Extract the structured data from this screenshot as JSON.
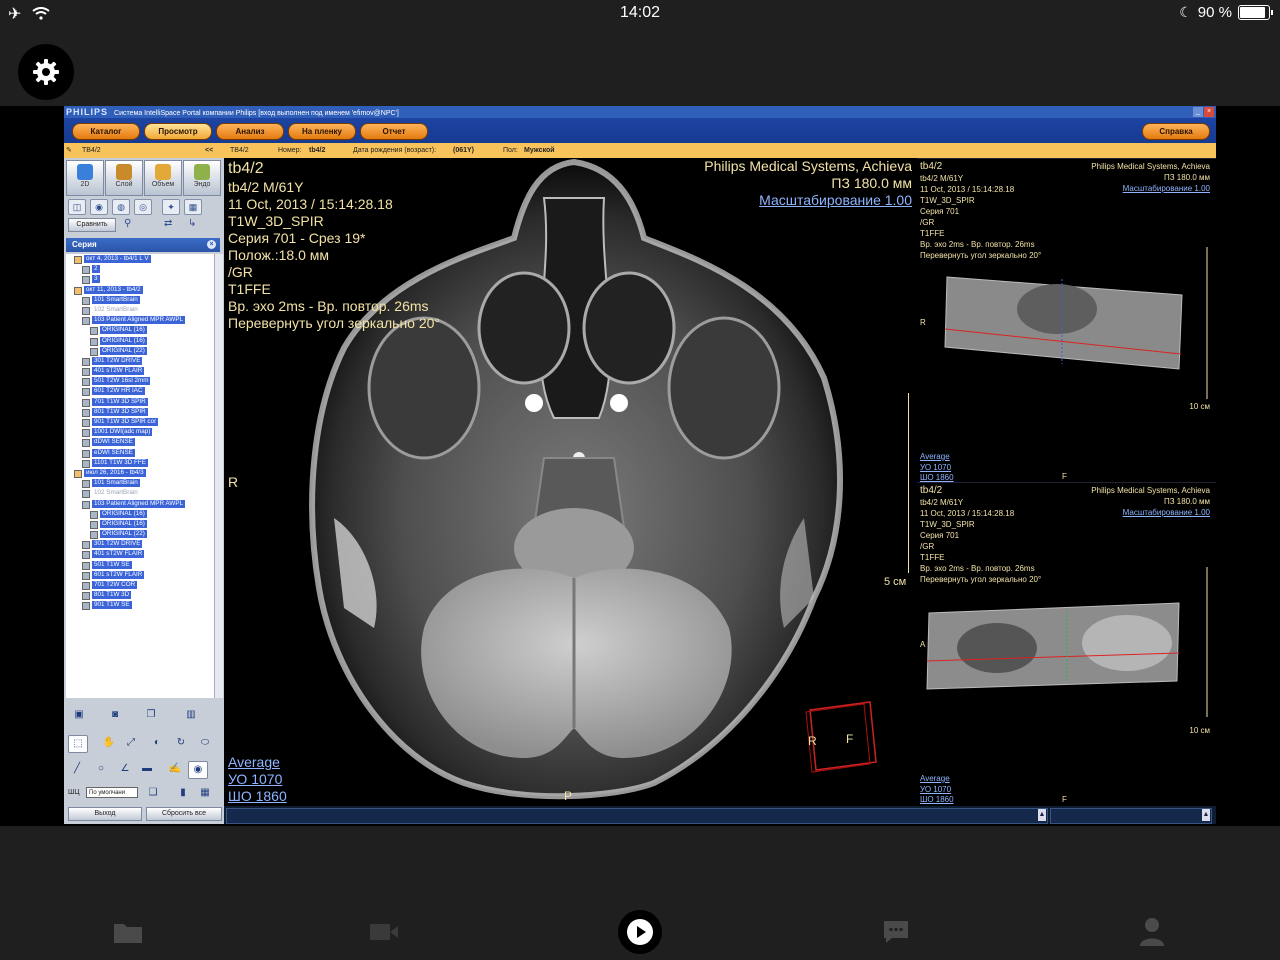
{
  "ios": {
    "time": "14:02",
    "battery": "90 %",
    "battery_level": 0.9
  },
  "window": {
    "brand": "PHILIPS",
    "title": "Система IntelliSpace Portal компании Philips [вход выполнен под именем 'efimov@NPC']",
    "menu": {
      "catalog": "Каталог",
      "view": "Просмотр",
      "analysis": "Анализ",
      "to_film": "На пленку",
      "report": "Отчет",
      "help": "Справка"
    }
  },
  "infobar": {
    "patient_tab": "ТВ4/2",
    "close_tab": "<<",
    "patient": "ТВ4/2",
    "number_label": "Номер:",
    "number_value": "tb4/2",
    "dob_label": "Дата рождения (возраст):",
    "dob_value": "(061Y)",
    "sex_label": "Пол:",
    "sex_value": "Мужской"
  },
  "left_panel": {
    "tools": [
      {
        "label": "2D",
        "color": "#3a7fd9"
      },
      {
        "label": "Слой",
        "color": "#c88a2a"
      },
      {
        "label": "Объем",
        "color": "#e2a938"
      },
      {
        "label": "Эндо",
        "color": "#8fb14c"
      }
    ],
    "compare": "Сравнить",
    "series_header": "Серия",
    "tree": [
      {
        "indent": 0,
        "box": "study",
        "label": "окт 4, 2013 - tb4/1 L V",
        "gray": false
      },
      {
        "indent": 1,
        "box": "series",
        "label": "2",
        "gray": false
      },
      {
        "indent": 1,
        "box": "series",
        "label": "3",
        "gray": false
      },
      {
        "indent": 0,
        "box": "study",
        "label": "окт 11, 2013 - tb4/2",
        "gray": false
      },
      {
        "indent": 1,
        "box": "series",
        "label": "101 SmartBrain",
        "gray": false
      },
      {
        "indent": 1,
        "box": "series",
        "label": "102 SmartBrain",
        "gray": true
      },
      {
        "indent": 1,
        "box": "series",
        "label": "103 Patient Aligned MPR AWPL",
        "gray": false
      },
      {
        "indent": 2,
        "box": "series",
        "label": "ORIGINAL (16)",
        "gray": false
      },
      {
        "indent": 2,
        "box": "series",
        "label": "ORIGINAL (16)",
        "gray": false
      },
      {
        "indent": 2,
        "box": "series",
        "label": "ORIGINAL (22)",
        "gray": false
      },
      {
        "indent": 1,
        "box": "series",
        "label": "301 T2W DRIVE",
        "gray": false
      },
      {
        "indent": 1,
        "box": "series",
        "label": "401 sT2W FLAIR",
        "gray": false
      },
      {
        "indent": 1,
        "box": "series",
        "label": "501 T2W 16sl 2mm",
        "gray": false
      },
      {
        "indent": 1,
        "box": "series",
        "label": "601 T2W HR IAC",
        "gray": false
      },
      {
        "indent": 1,
        "box": "series",
        "label": "701 T1W 3D SPIR",
        "gray": false
      },
      {
        "indent": 1,
        "box": "series",
        "label": "801 T1W 3D SPIR",
        "gray": false
      },
      {
        "indent": 1,
        "box": "series",
        "label": "901 T1W 3D SPIR cor",
        "gray": false
      },
      {
        "indent": 1,
        "box": "series",
        "label": "1001 DWI(adc map)",
        "gray": false
      },
      {
        "indent": 1,
        "box": "series",
        "label": "dDWI SENSE",
        "gray": false
      },
      {
        "indent": 1,
        "box": "series",
        "label": "eDWI SENSE",
        "gray": false
      },
      {
        "indent": 1,
        "box": "series",
        "label": "1101 T1W 3D FFE",
        "gray": false
      },
      {
        "indent": 0,
        "box": "study",
        "label": "июл 26, 2016 - tb4/3",
        "gray": false
      },
      {
        "indent": 1,
        "box": "series",
        "label": "101 SmartBrain",
        "gray": false
      },
      {
        "indent": 1,
        "box": "series",
        "label": "102 SmartBrain",
        "gray": true
      },
      {
        "indent": 1,
        "box": "series",
        "label": "103 Patient Aligned MPR AWPL",
        "gray": false
      },
      {
        "indent": 2,
        "box": "series",
        "label": "ORIGINAL (16)",
        "gray": false
      },
      {
        "indent": 2,
        "box": "series",
        "label": "ORIGINAL (16)",
        "gray": false
      },
      {
        "indent": 2,
        "box": "series",
        "label": "ORIGINAL (22)",
        "gray": false
      },
      {
        "indent": 1,
        "box": "series",
        "label": "301 T2W DRIVE",
        "gray": false
      },
      {
        "indent": 1,
        "box": "series",
        "label": "401 sT2W FLAIR",
        "gray": false
      },
      {
        "indent": 1,
        "box": "series",
        "label": "501 T1W SE",
        "gray": false
      },
      {
        "indent": 1,
        "box": "series",
        "label": "601 sT2W FLAIR",
        "gray": false
      },
      {
        "indent": 1,
        "box": "series",
        "label": "701 T2W COR",
        "gray": false
      },
      {
        "indent": 1,
        "box": "series",
        "label": "801 T1W 3D",
        "gray": false
      },
      {
        "indent": 1,
        "box": "series",
        "label": "901 T1W SE",
        "gray": false
      }
    ],
    "wl_label": "ШЦ",
    "wl_value": "По умолчани",
    "exit": "Выход",
    "reset_all": "Сбросить все"
  },
  "main_view": {
    "study": "tb4/2",
    "patient": "tb4/2 M/61Y",
    "datetime": "11 Oct, 2013 / 15:14:28.18",
    "protocol": "T1W_3D_SPIR",
    "series_slice": "Серия 701 - Срез 19*",
    "position": "Полож.:18.0 мм",
    "gr": "/GR",
    "tiffe": "T1FFE",
    "echo": "Вр. эхо   2ms - Вр. повтор.  26ms",
    "flip": "Перевернуть угол зеркально 20°",
    "vendor": "Philips Medical Systems, Achieva",
    "fov": "ПЗ 180.0 мм",
    "zoom": "Масштабирование 1.00",
    "orient_left": "R",
    "orient_bottom": "P",
    "scale": "5 см",
    "average": "Average",
    "wl_level": "УО   1070",
    "wl_width": "ШО   1860",
    "cube_r": "R",
    "cube_f": "F"
  },
  "right_top": {
    "study": "tb4/2",
    "patient": "tb4/2 M/61Y",
    "datetime": "11 Oct, 2013 / 15:14:28.18",
    "protocol": "T1W_3D_SPIR",
    "series": "Серия 701",
    "gr": "/GR",
    "tiffe": "T1FFE",
    "echo": "Вр. эхо   2ms - Вр. повтор.  26ms",
    "flip": "Перевернуть угол зеркально 20°",
    "vendor": "Philips Medical Systems, Achieva",
    "fov": "ПЗ 180.0 мм",
    "zoom": "Масштабирование 1.00",
    "orient": "R",
    "scale": "10 см",
    "average": "Average",
    "wl_level": "УО   1070",
    "wl_width": "ШО   1860",
    "bottom": "F"
  },
  "right_bottom": {
    "study": "tb4/2",
    "patient": "tb4/2 M/61Y",
    "datetime": "11 Oct, 2013 / 15:14:28.18",
    "protocol": "T1W_3D_SPIR",
    "series": "Серия 701",
    "gr": "/GR",
    "tiffe": "T1FFE",
    "echo": "Вр. эхо   2ms - Вр. повтор.  26ms",
    "flip": "Перевернуть угол зеркально 20°",
    "vendor": "Philips Medical Systems, Achieva",
    "fov": "ПЗ 180.0 мм",
    "zoom": "Масштабирование 1.00",
    "orient": "A",
    "scale": "10 см",
    "average": "Average",
    "wl_level": "УО   1070",
    "wl_width": "ШО   1860",
    "bottom": "F"
  }
}
